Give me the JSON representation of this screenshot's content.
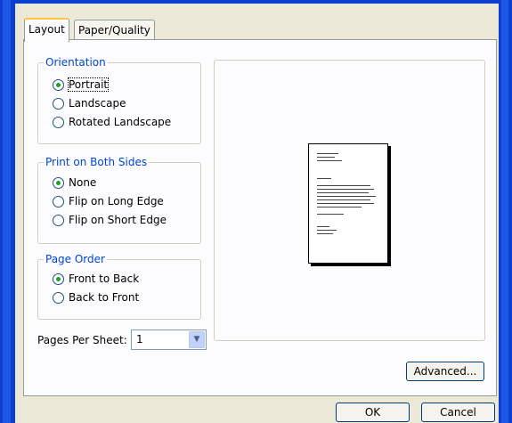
{
  "tabs": [
    {
      "label": "Layout"
    },
    {
      "label": "Paper/Quality"
    }
  ],
  "orientation": {
    "title": "Orientation",
    "options": [
      {
        "label": "Portrait",
        "selected": true
      },
      {
        "label": "Landscape",
        "selected": false
      },
      {
        "label": "Rotated Landscape",
        "selected": false
      }
    ]
  },
  "print_both_sides": {
    "title": "Print on Both Sides",
    "options": [
      {
        "label": "None",
        "selected": true
      },
      {
        "label": "Flip on Long Edge",
        "selected": false
      },
      {
        "label": "Flip on Short Edge",
        "selected": false
      }
    ]
  },
  "page_order": {
    "title": "Page Order",
    "options": [
      {
        "label": "Front to Back",
        "selected": true
      },
      {
        "label": "Back to Front",
        "selected": false
      }
    ]
  },
  "pages_per_sheet": {
    "label": "Pages Per Sheet:",
    "value": "1"
  },
  "buttons": {
    "advanced": "Advanced...",
    "ok": "OK",
    "cancel": "Cancel"
  }
}
